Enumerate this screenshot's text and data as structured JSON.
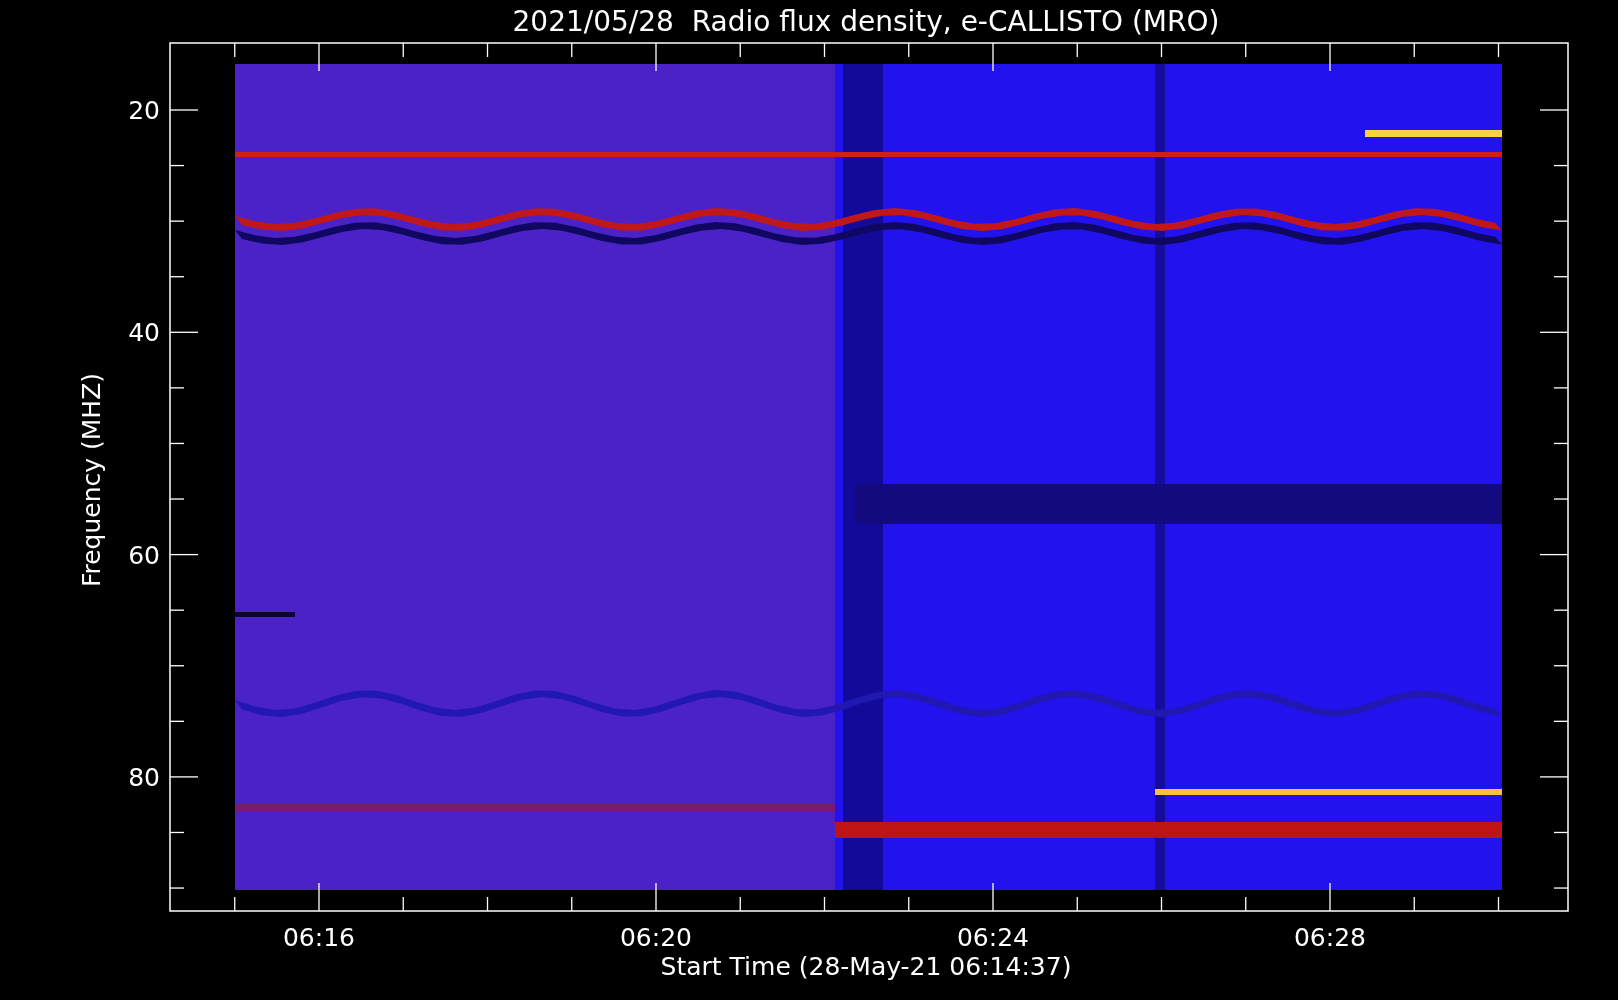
{
  "title": "2021/05/28  Radio flux density, e-CALLISTO (MRO)",
  "y_axis": {
    "label": "Frequency (MHZ)",
    "ticks": [
      "20",
      "40",
      "60",
      "80"
    ]
  },
  "x_axis": {
    "label": "Start Time (28-May-21 06:14:37)",
    "ticks": [
      "06:16",
      "06:20",
      "06:24",
      "06:28"
    ]
  }
}
